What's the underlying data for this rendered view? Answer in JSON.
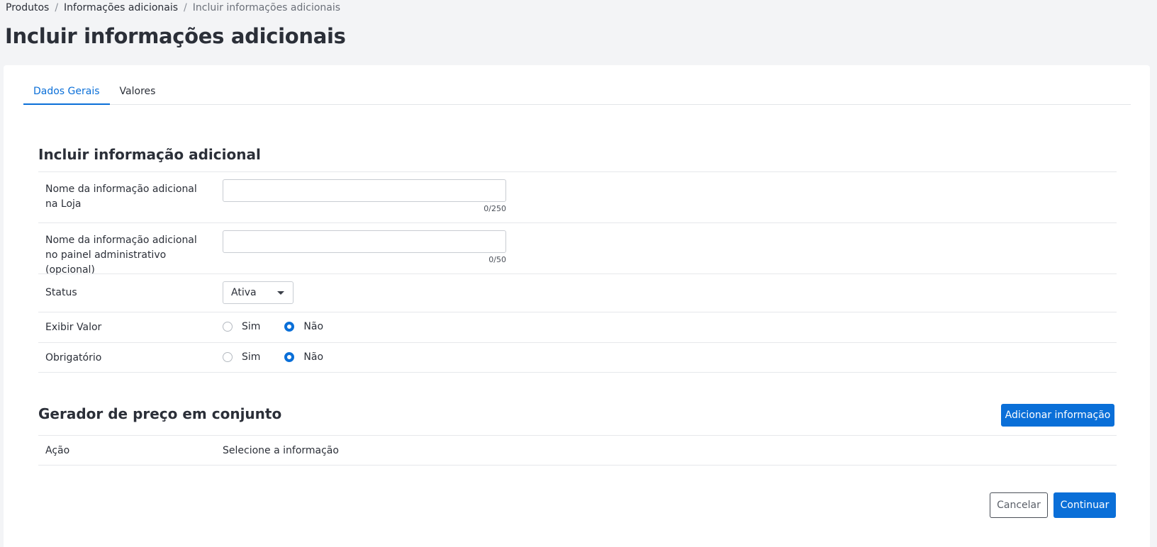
{
  "breadcrumb": {
    "items": [
      "Produtos",
      "Informações adicionais"
    ],
    "current": "Incluir informações adicionais",
    "separator": "/"
  },
  "page_title": "Incluir informações adicionais",
  "tabs": [
    {
      "label": "Dados Gerais",
      "active": true
    },
    {
      "label": "Valores",
      "active": false
    }
  ],
  "section1": {
    "title": "Incluir informação adicional",
    "fields": {
      "store_name": {
        "label": "Nome da informação adicional na Loja",
        "value": "",
        "counter": "0/250"
      },
      "admin_name": {
        "label": "Nome da informação adicional no painel administrativo (opcional)",
        "value": "",
        "counter": "0/50"
      },
      "status": {
        "label": "Status",
        "selected": "Ativa"
      },
      "show_value": {
        "label": "Exibir Valor",
        "options": [
          "Sim",
          "Não"
        ],
        "selected": "Não"
      },
      "required": {
        "label": "Obrigatório",
        "options": [
          "Sim",
          "Não"
        ],
        "selected": "Não"
      }
    }
  },
  "section2": {
    "title": "Gerador de preço em conjunto",
    "add_button": "Adicionar informação",
    "row": {
      "label": "Ação",
      "value": "Selecione a informação"
    }
  },
  "footer": {
    "cancel": "Cancelar",
    "continue": "Continuar"
  },
  "colors": {
    "accent": "#0a6fd8",
    "background": "#f3f4f6",
    "card": "#ffffff"
  }
}
